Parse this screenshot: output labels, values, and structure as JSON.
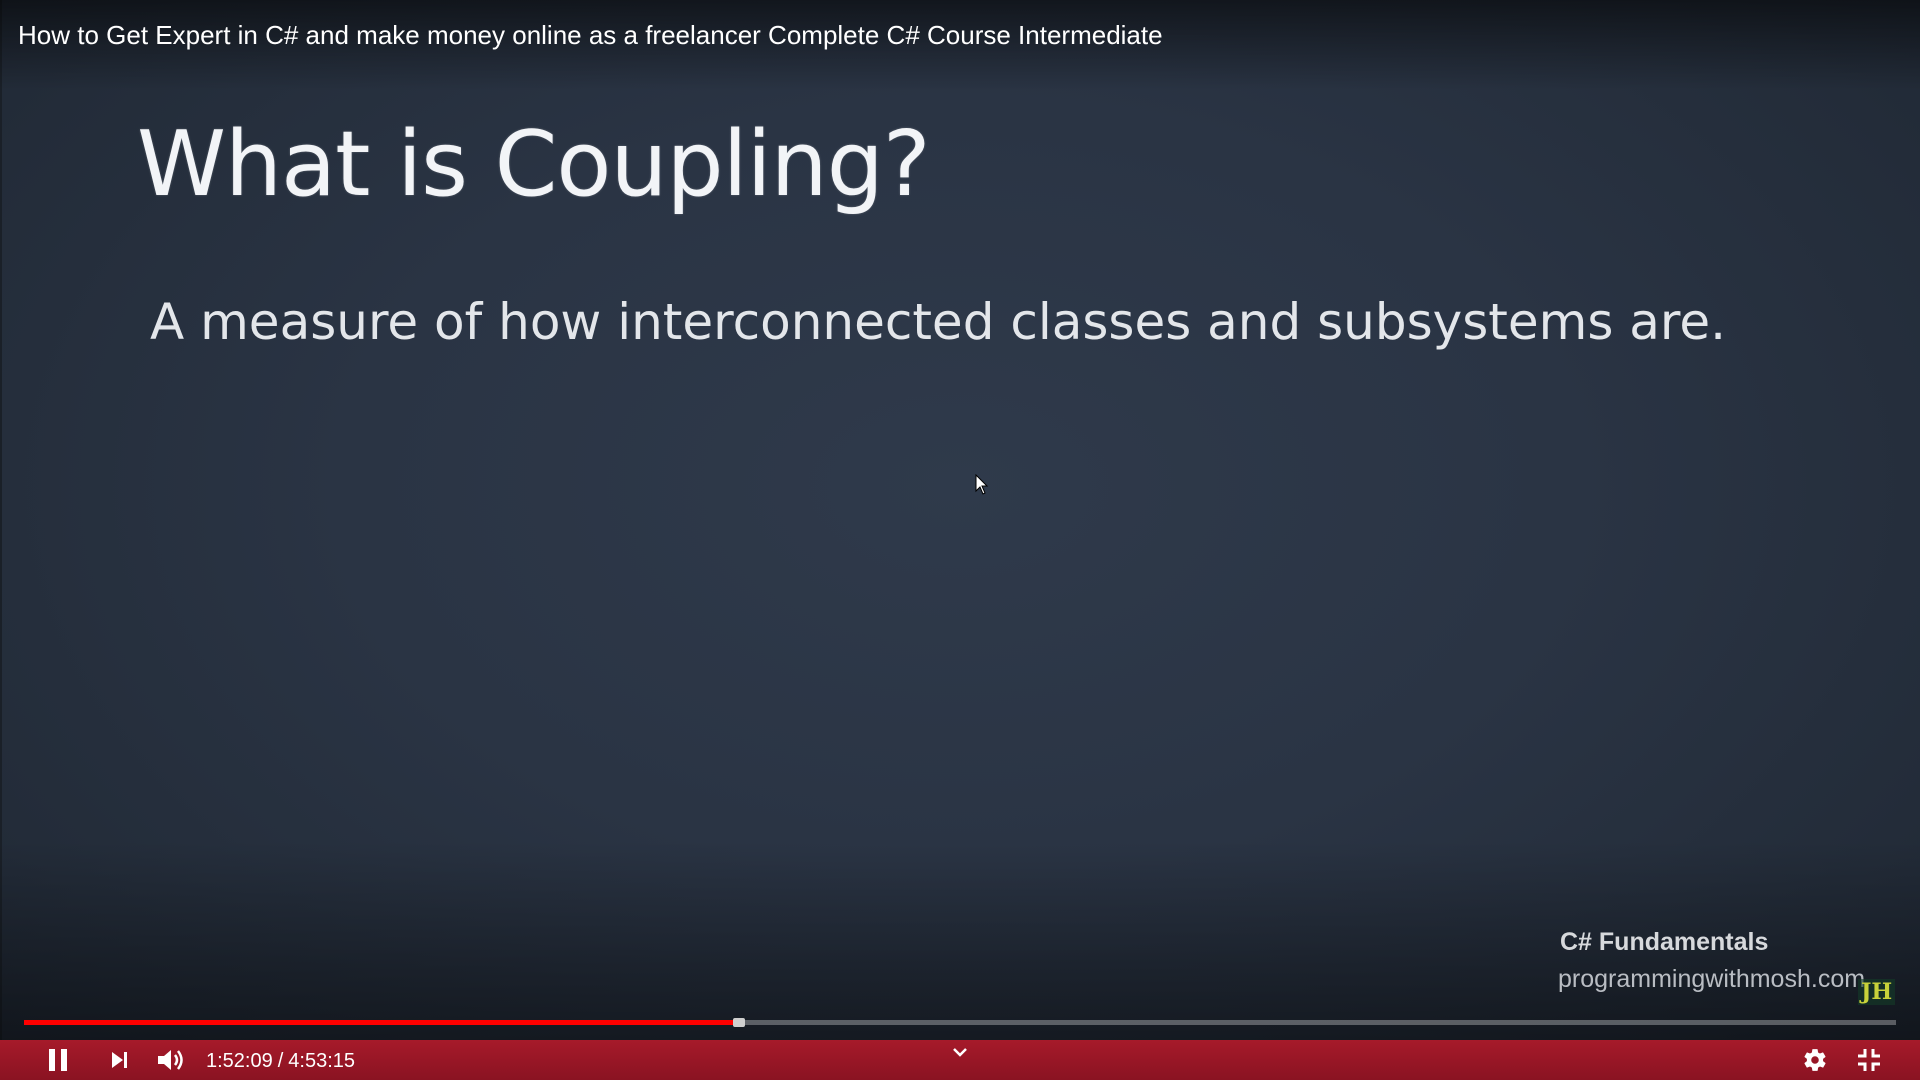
{
  "player": {
    "video_title": "How to Get Expert in C# and make money online as a freelancer Complete C# Course Intermediate",
    "progress_fraction": 0.38,
    "colors": {
      "progress": "#ff0000",
      "control_bar": "#9a1726",
      "slide_background": "#2b3545"
    }
  },
  "slide": {
    "heading": "What is Coupling?",
    "body": "A measure of how interconnected classes and subsystems are."
  },
  "watermark": {
    "course": "C# Fundamentals",
    "site": "programmingwithmosh.com",
    "logo_text": "JH"
  },
  "controls": {
    "current_time": "1:52:09",
    "separator": "/",
    "duration": "4:53:15",
    "icons": [
      "pause-icon",
      "next-icon",
      "volume-icon",
      "chevron-down-icon",
      "gear-icon",
      "exit-fullscreen-icon"
    ]
  }
}
